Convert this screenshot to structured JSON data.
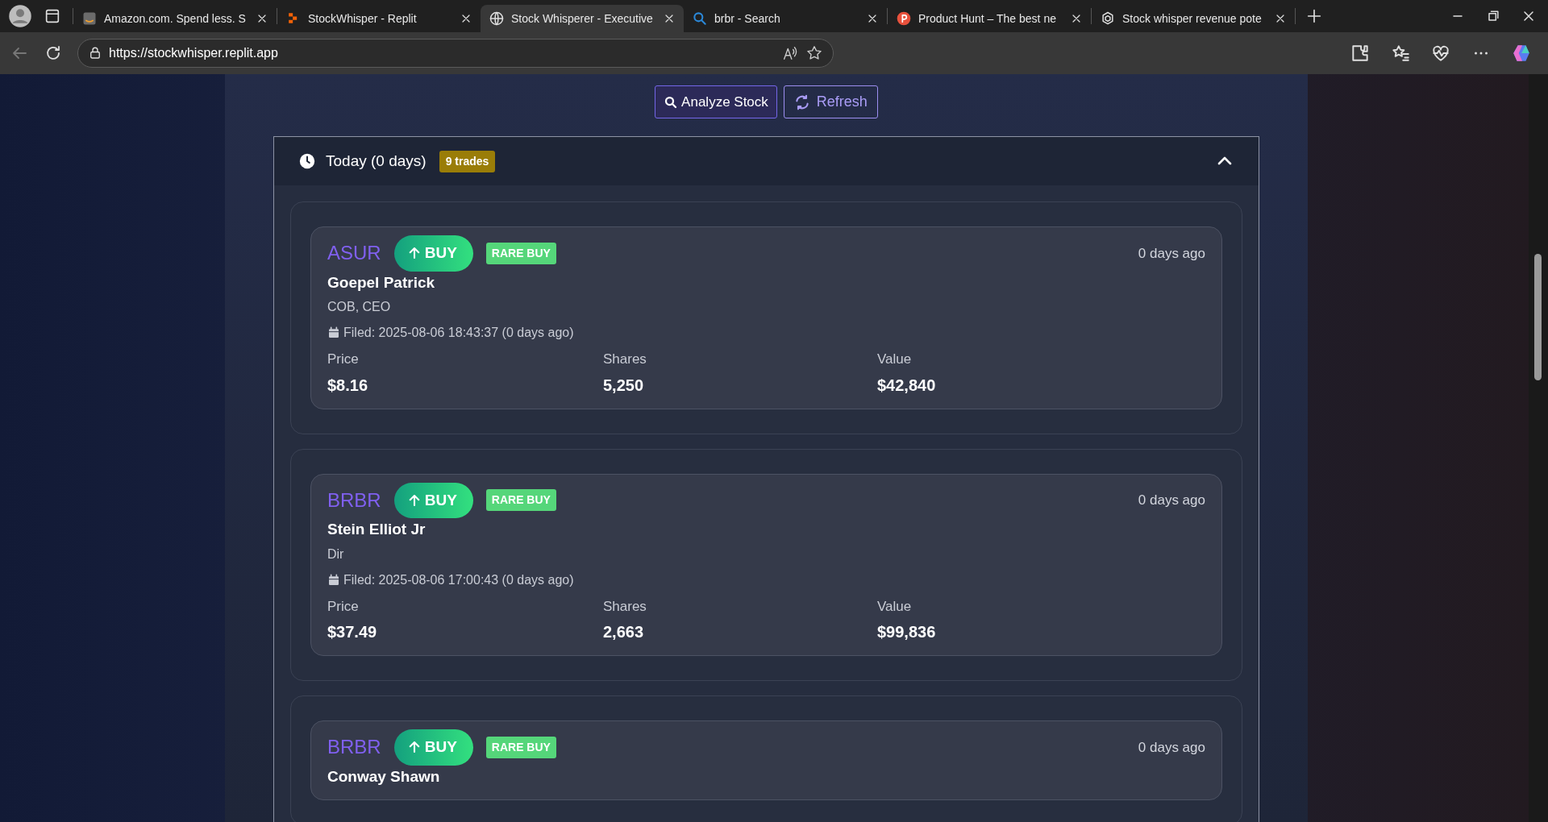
{
  "browser": {
    "tabs": [
      {
        "title": "Amazon.com. Spend less. S",
        "selected": false
      },
      {
        "title": "StockWhisper - Replit",
        "selected": false
      },
      {
        "title": "Stock Whisperer - Executive",
        "selected": true
      },
      {
        "title": "brbr - Search",
        "selected": false
      },
      {
        "title": "Product Hunt – The best ne",
        "selected": false
      },
      {
        "title": "Stock whisper revenue pote",
        "selected": false
      }
    ],
    "url": "https://stockwhisper.replit.app"
  },
  "page": {
    "buttons": [
      {
        "label": "Analyze Stock",
        "kind": "search"
      },
      {
        "label": "Refresh",
        "kind": "refresh"
      }
    ],
    "section": {
      "title": "Today (0 days)",
      "count": "9 trades",
      "expanded": true
    },
    "trades": [
      {
        "ticker": "ASUR",
        "action": "BUY",
        "tag": "RARE BUY",
        "ago": "0 days ago",
        "name": "Goepel Patrick",
        "role": "COB, CEO",
        "filed": "Filed: 2025-08-06 18:43:37 (0 days ago)",
        "stats": [
          {
            "label": "Price",
            "value": "$8.16"
          },
          {
            "label": "Shares",
            "value": "5,250"
          },
          {
            "label": "Value",
            "value": "$42,840"
          }
        ]
      },
      {
        "ticker": "BRBR",
        "action": "BUY",
        "tag": "RARE BUY",
        "ago": "0 days ago",
        "name": "Stein Elliot Jr",
        "role": "Dir",
        "filed": "Filed: 2025-08-06 17:00:43 (0 days ago)",
        "stats": [
          {
            "label": "Price",
            "value": "$37.49"
          },
          {
            "label": "Shares",
            "value": "2,663"
          },
          {
            "label": "Value",
            "value": "$99,836"
          }
        ]
      },
      {
        "ticker": "BRBR",
        "action": "BUY",
        "tag": "RARE BUY",
        "ago": "0 days ago",
        "name": "Conway Shawn"
      }
    ]
  }
}
